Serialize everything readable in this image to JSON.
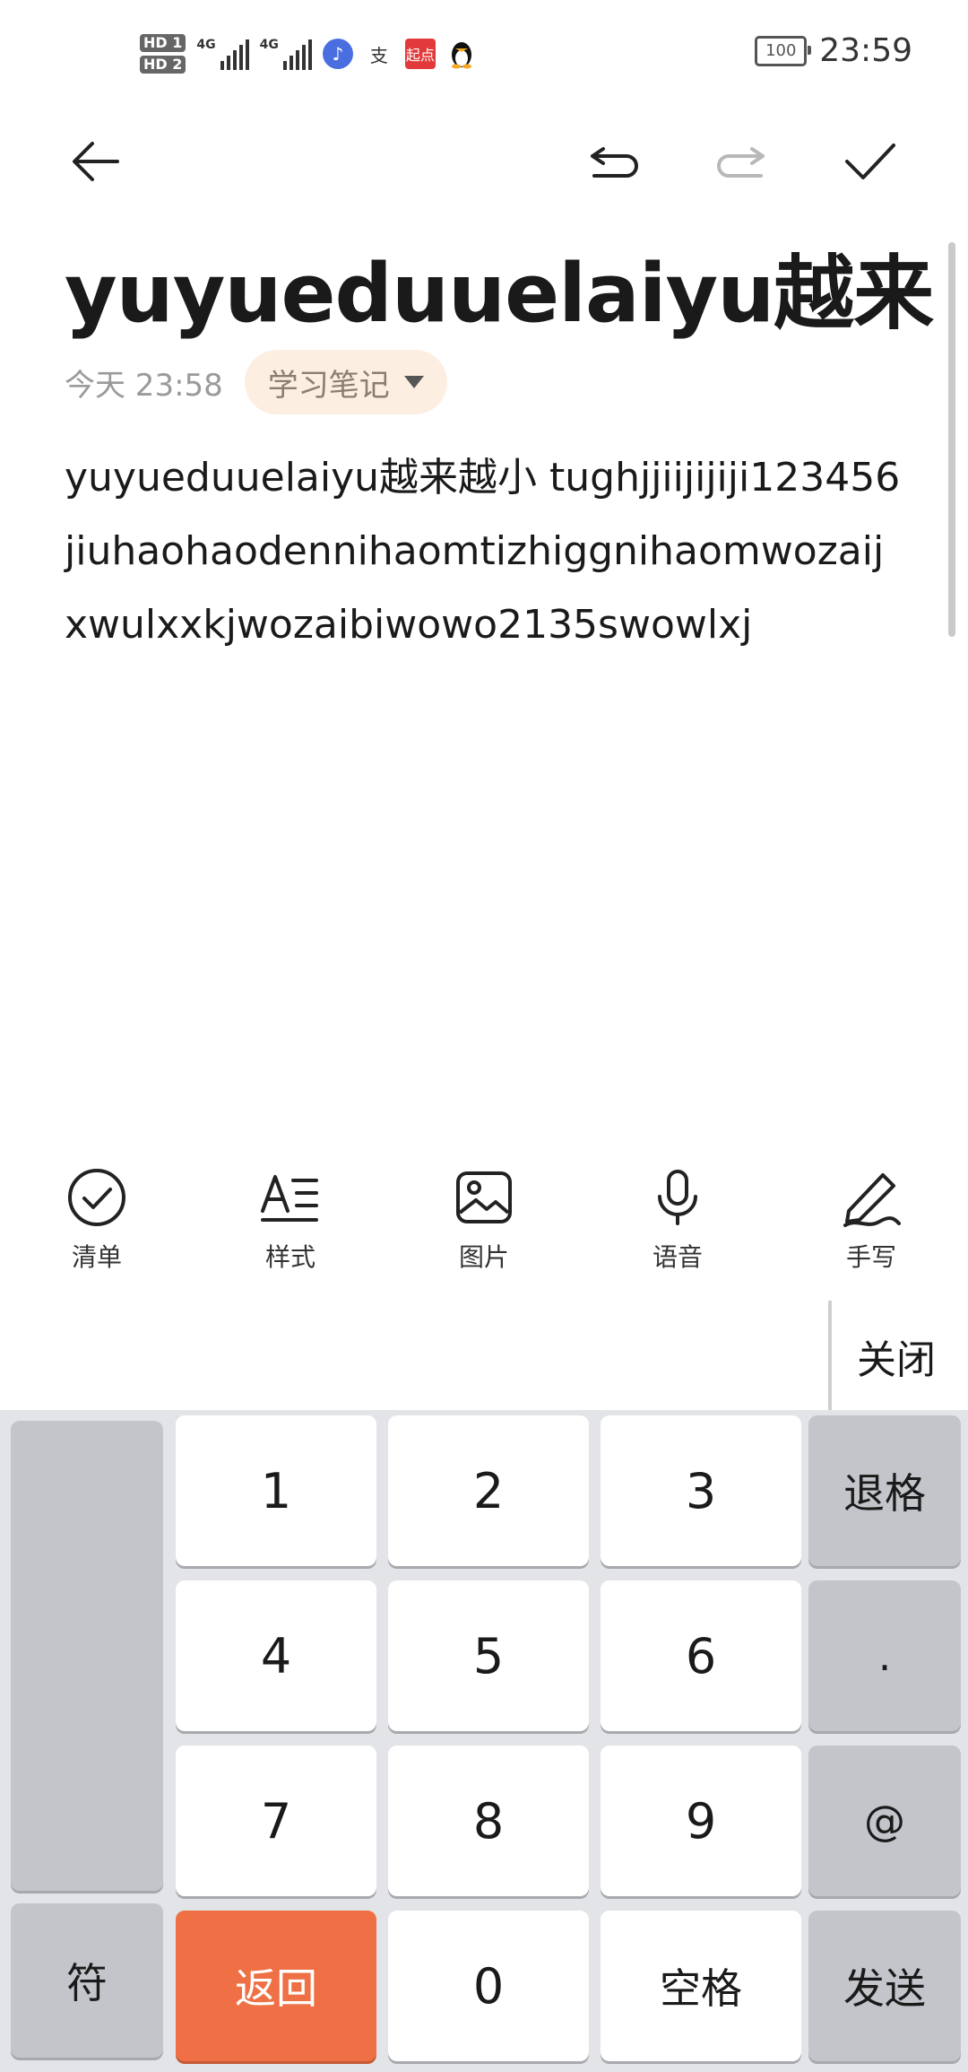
{
  "status_bar": {
    "sim1": "HD 1",
    "sim2": "HD 2",
    "net1": "4G",
    "net2": "4G",
    "battery": "100",
    "time": "23:59",
    "app_icons": [
      "music-icon",
      "alipay-icon",
      "qidian-icon",
      "qq-penguin-icon"
    ]
  },
  "note": {
    "title": "yuyueduuelaiyu越来",
    "date": "今天 23:58",
    "notebook": "学习笔记",
    "body": "yuyueduuelaiyu越来越小 tughjjiijijiji123456jiuhaohaodennihaomtizhiggnihaomwozaijxwulxxkjwozaibiwowo2135swowlxj"
  },
  "toolbar": {
    "checklist": "清单",
    "style": "样式",
    "image": "图片",
    "voice": "语音",
    "handwrite": "手写",
    "close": "关闭"
  },
  "keyboard": {
    "k1": "1",
    "k2": "2",
    "k3": "3",
    "k4": "4",
    "k5": "5",
    "k6": "6",
    "k7": "7",
    "k8": "8",
    "k9": "9",
    "k0": "0",
    "backspace": "退格",
    "dot": ".",
    "at": "@",
    "symbols": "符",
    "back": "返回",
    "space": "空格",
    "send": "发送"
  }
}
